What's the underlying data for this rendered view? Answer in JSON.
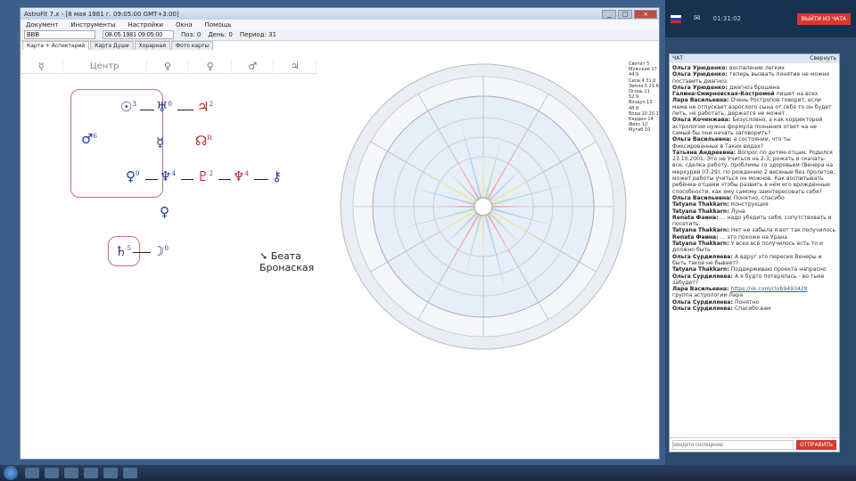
{
  "window": {
    "title": "AstroFit 7.x - [8 мая 1981 г. 09:05:00 GMT+3:00]",
    "menu": [
      "Документ",
      "Инструменты",
      "Настройки",
      "Окна",
      "Помощь"
    ],
    "toolbar": {
      "field1": "ВВВ",
      "field2": "08.05.1981 09:05:00",
      "label_pos": "Поз: 0",
      "label_day": "День: 0",
      "label_period": "Период: 31"
    },
    "tabs": [
      "Карта + Аспектарий",
      "Карта Души",
      "Хорарная",
      "Фото карты"
    ]
  },
  "grid": {
    "headers": [
      "☿",
      "Центр",
      "♀",
      "♀",
      "♂",
      "♃"
    ],
    "planets": [
      {
        "glyph": "☉",
        "sup": "3",
        "color": "blue"
      },
      {
        "glyph": "♅",
        "sup": "0",
        "color": "blue"
      },
      {
        "glyph": "♃",
        "sup": "2",
        "color": "red"
      },
      {
        "glyph": "♂",
        "sup": "6",
        "color": "blue"
      },
      {
        "glyph": "☿",
        "sup": "",
        "color": "blue"
      },
      {
        "glyph": "☊",
        "sup": "R",
        "color": "red"
      },
      {
        "glyph": "♀",
        "sup": "0",
        "color": "blue"
      },
      {
        "glyph": "♆",
        "sup": "4",
        "color": "blue"
      },
      {
        "glyph": "♇",
        "sup": "2",
        "color": "red"
      },
      {
        "glyph": "♆",
        "sup": "4",
        "color": "red"
      },
      {
        "glyph": "⚷",
        "sup": "",
        "color": "blue"
      },
      {
        "glyph": "♀",
        "sup": "",
        "color": "blue"
      },
      {
        "glyph": "♄",
        "sup": "5",
        "color": "blue"
      },
      {
        "glyph": "☽",
        "sup": "0",
        "color": "blue"
      }
    ],
    "tooltip": "Беата Бронаская"
  },
  "table": {
    "rows": [
      "Светит 5",
      "Мужские 17 44.9",
      "Сила 4 31.0",
      "Земля 5 21.6",
      "Огонь 11 52.9",
      "Воздух 13 48.8",
      "Вода 10 20.1",
      "Кардин 14",
      "Фикс 12",
      "Мутаб 10"
    ]
  },
  "chat": {
    "timer": "01:31:02",
    "leave_label": "ВЫЙТИ ИЗ ЧАТА",
    "header_left": "ЧАТ",
    "header_right": "Свернуть",
    "messages": [
      {
        "name": "Ольга Урюденко:",
        "text": "воспаление легких"
      },
      {
        "name": "Ольга Урюденко:",
        "text": "теперь вызвать понятие не можно поставить диагноз"
      },
      {
        "name": "Ольга Урюденко:",
        "text": "диагноз брошена"
      },
      {
        "name": "Галина-Смирновская-Костромой",
        "text": "пишет на всех"
      },
      {
        "name": "Лара Васильевна:",
        "text": "Очень Ростропов говорит, если мама не отпускает взрослого сына от себя то он будет пить, не работать, держатся не может."
      },
      {
        "name": "Ольга Коченжава:",
        "text": "Безусловно, а как корректорой астрологии нужна формула познания ответ на не самый бы они начать заговорить?"
      },
      {
        "name": "Ольга Васильевна:",
        "text": "а состоянии, что ты Фиксированных в Таких видах?"
      },
      {
        "name": "Татьяна Андреевна:",
        "text": "Вопрос по детям-отцам. Родился 23.10.2001. Это не Учиться на 2-3, рожать и скачать-все, сделка работу, проблемы со здоровьем (Венера на меркурий 07-29), по рождению 2 весеные без пролетов; может работы учиться он можнов. Как воспитывать ребёнка-отцами чтобы развить в нём его врождённые способности, как ему самому заинтересовать себя?"
      },
      {
        "name": "Ольга Васильевна:",
        "text": "Понятно, спасибо"
      },
      {
        "name": "Tatyana Thakkarn:",
        "text": "Конструкция"
      },
      {
        "name": "Tatyana Thakkarn:",
        "text": "Луна"
      },
      {
        "name": "Renata Фаина:",
        "text": "... надо убедить себя, сопутствовать и посетить."
      },
      {
        "name": "Tatyana Thakkarn:",
        "text": "Нет не забыла я вот так получилось"
      },
      {
        "name": "Renata Фаина:",
        "text": "... это похоже на Урана"
      },
      {
        "name": "Tatyana Thakkarn:",
        "text": "У всех всё получилось есть то и должно быть"
      },
      {
        "name": "Ольга Сурдиляева:",
        "text": "А вдруг это пересия Венеры и быть такое не бывает?"
      },
      {
        "name": "Tatyana Thakkarn:",
        "text": "Поддерживаю проекта напрасно"
      },
      {
        "name": "Ольга Сурдиляева:",
        "text": "А я будто потерялась - во тьме забудет?"
      },
      {
        "name": "Лара Васильевна:",
        "text": "https://vk.com/club9493429",
        "link": true
      },
      {
        "name": "",
        "text": "группа астрологии Лара"
      },
      {
        "name": "Ольга Сурдиляева:",
        "text": "Понятно"
      },
      {
        "name": "Ольга Сурдиляева:",
        "text": "Спасибо вам"
      }
    ],
    "input_placeholder": "Введите сообщение",
    "send_label": "ОТПРАВИТЬ"
  }
}
